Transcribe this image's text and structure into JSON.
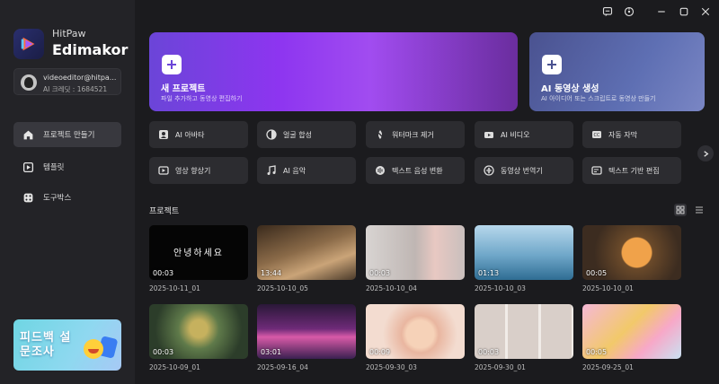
{
  "app": {
    "brand_top": "HitPaw",
    "brand_main": "Edimakor"
  },
  "account": {
    "email": "videoeditor@hitpa...",
    "credit": "AI 크레딧 : 1684521"
  },
  "sidebar": {
    "items": [
      {
        "label": "프로젝트 만들기",
        "icon": "home-icon",
        "active": true
      },
      {
        "label": "템플릿",
        "icon": "template-icon",
        "active": false
      },
      {
        "label": "도구박스",
        "icon": "toolbox-icon",
        "active": false
      }
    ],
    "survey_label": "피드백 설문조사"
  },
  "hero": {
    "new_project": {
      "title": "새 프로젝트",
      "subtitle": "파일 추가하고 동영상 편집하기"
    },
    "ai_video": {
      "title": "AI 동영상 생성",
      "subtitle": "AI 아이디어 또는 스크립트로 동영상 만들기"
    }
  },
  "tools": [
    {
      "label": "AI 아바타",
      "icon": "avatar-icon"
    },
    {
      "label": "얼굴 합성",
      "icon": "face-swap-icon"
    },
    {
      "label": "워터마크 제거",
      "icon": "watermark-remove-icon"
    },
    {
      "label": "AI 비디오",
      "icon": "ai-video-icon"
    },
    {
      "label": "자동 자막",
      "icon": "subtitle-icon"
    },
    {
      "label": "영상 향상기",
      "icon": "enhance-icon"
    },
    {
      "label": "AI 음악",
      "icon": "music-icon"
    },
    {
      "label": "텍스트 음성 변환",
      "icon": "tts-icon"
    },
    {
      "label": "동영상 번역기",
      "icon": "translate-icon"
    },
    {
      "label": "텍스트 기반 편집",
      "icon": "text-edit-icon"
    }
  ],
  "projects_title": "프로젝트",
  "projects": [
    {
      "name": "2025-10-11_01",
      "duration": "00:03",
      "thumb_text": "안녕하세요"
    },
    {
      "name": "2025-10-10_05",
      "duration": "13:44"
    },
    {
      "name": "2025-10-10_04",
      "duration": "00:03"
    },
    {
      "name": "2025-10-10_03",
      "duration": "01:13"
    },
    {
      "name": "2025-10-10_01",
      "duration": "00:05"
    },
    {
      "name": "2025-10-09_01",
      "duration": "00:03"
    },
    {
      "name": "2025-09-16_04",
      "duration": "03:01"
    },
    {
      "name": "2025-09-30_03",
      "duration": "00:09"
    },
    {
      "name": "2025-09-30_01",
      "duration": "00:03"
    },
    {
      "name": "2025-09-25_01",
      "duration": "00:05"
    }
  ],
  "colors": {
    "accent": "#8d35f0",
    "background": "#1b1b1e",
    "sidebar": "#232327"
  }
}
